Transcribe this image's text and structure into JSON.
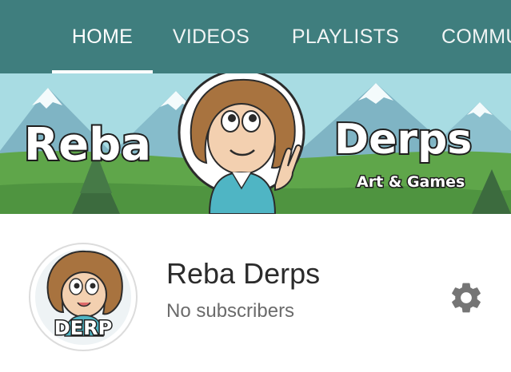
{
  "tabs": [
    {
      "label": "HOME",
      "active": true
    },
    {
      "label": "VIDEOS",
      "active": false
    },
    {
      "label": "PLAYLISTS",
      "active": false
    },
    {
      "label": "COMMUNITY",
      "active": false
    }
  ],
  "banner": {
    "title_left": "Reba",
    "title_right": "Derps",
    "tagline": "Art & Games"
  },
  "channel": {
    "avatar_text": "DERP",
    "name": "Reba Derps",
    "subscribers": "No subscribers"
  },
  "icons": {
    "settings": "gear-icon"
  },
  "colors": {
    "header_bg": "#3f7e7e",
    "tab_text": "#ffffff",
    "banner_sky": "#a8dce3",
    "banner_grass": "#5fa64a",
    "name_text": "#2b2b2b",
    "subs_text": "#6b6b6b",
    "gear": "#757575"
  }
}
